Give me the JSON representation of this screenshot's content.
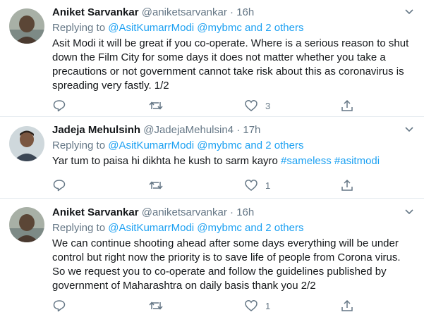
{
  "tweets": [
    {
      "name": "Aniket Sarvankar",
      "handle": "@aniketsarvankar",
      "dot": "·",
      "time": "16h",
      "reply_prefix": "Replying to",
      "reply_mentions": "@AsitKumarrModi @mybmc",
      "reply_and": "and",
      "reply_others": "2 others",
      "text": "Asit Modi it will be great if you co-operate. Where is a serious reason to shut down the Film City for some days it does not matter whether you take a precautions or not government cannot take risk about this as coronavirus is spreading very fastly. 1/2",
      "replies": "",
      "retweets": "",
      "likes": "3"
    },
    {
      "name": "Jadeja Mehulsinh",
      "handle": "@JadejaMehulsin4",
      "dot": "·",
      "time": "17h",
      "reply_prefix": "Replying to",
      "reply_mentions": "@AsitKumarrModi @mybmc",
      "reply_and": "and",
      "reply_others": "2 others",
      "text": "Yar tum to paisa hi dikhta he kush to sarm kayro",
      "hashtags": "#sameless #asitmodi",
      "replies": "",
      "retweets": "",
      "likes": "1"
    },
    {
      "name": "Aniket Sarvankar",
      "handle": "@aniketsarvankar",
      "dot": "·",
      "time": "16h",
      "reply_prefix": "Replying to",
      "reply_mentions": "@AsitKumarrModi @mybmc",
      "reply_and": "and",
      "reply_others": "2 others",
      "text": "We can continue shooting ahead after some days everything will be under control but right now the priority is to save life of people from Corona virus. So we request you to co-operate and follow the guidelines published by government of Maharashtra on daily basis thank you 2/2",
      "replies": "",
      "retweets": "",
      "likes": "1"
    }
  ],
  "icons": {
    "reply": "reply-icon",
    "retweet": "retweet-icon",
    "like": "heart-icon",
    "share": "share-icon",
    "menu": "chevron-down-icon"
  },
  "colors": {
    "link": "#1da1f2",
    "secondary": "#657786",
    "text": "#14171a",
    "border": "#e6ecf0"
  }
}
